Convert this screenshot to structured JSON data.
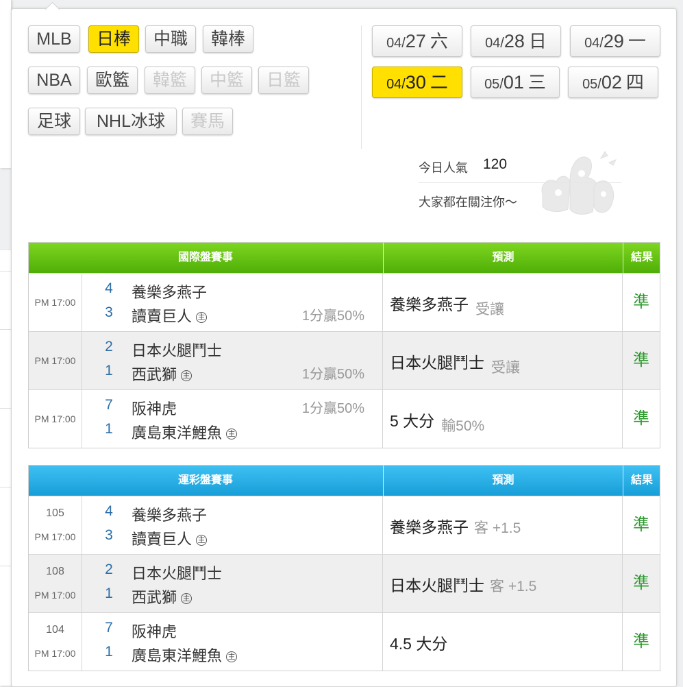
{
  "sports": [
    {
      "label": "MLB",
      "state": "normal"
    },
    {
      "label": "日棒",
      "state": "active"
    },
    {
      "label": "中職",
      "state": "normal"
    },
    {
      "label": "韓棒",
      "state": "normal"
    },
    {
      "label": "NBA",
      "state": "normal"
    },
    {
      "label": "歐籃",
      "state": "normal"
    },
    {
      "label": "韓籃",
      "state": "disabled"
    },
    {
      "label": "中籃",
      "state": "disabled"
    },
    {
      "label": "日籃",
      "state": "disabled"
    },
    {
      "label": "足球",
      "state": "normal"
    },
    {
      "label": "NHL冰球",
      "state": "normal"
    },
    {
      "label": "賽馬",
      "state": "disabled"
    }
  ],
  "dates": [
    {
      "month": "04/",
      "day": "27",
      "weekday": "六",
      "active": false
    },
    {
      "month": "04/",
      "day": "28",
      "weekday": "日",
      "active": false
    },
    {
      "month": "04/",
      "day": "29",
      "weekday": "一",
      "active": false
    },
    {
      "month": "04/",
      "day": "30",
      "weekday": "二",
      "active": true
    },
    {
      "month": "05/",
      "day": "01",
      "weekday": "三",
      "active": false
    },
    {
      "month": "05/",
      "day": "02",
      "weekday": "四",
      "active": false
    }
  ],
  "popularity": {
    "label": "今日人氣",
    "count": "120",
    "message": "大家都在關注你～"
  },
  "colors": {
    "active_yellow": "#ffe000",
    "green_header": "#5cb80e",
    "blue_header": "#1fa8e0",
    "score_blue": "#2b6ea8",
    "result_green": "#2f9a2f"
  },
  "international": {
    "header": {
      "match": "國際盤賽事",
      "prediction": "預測",
      "result": "結果"
    },
    "rows": [
      {
        "time": "PM 17:00",
        "away_score": "4",
        "away": "養樂多燕子",
        "home_score": "3",
        "home": "讀賣巨人",
        "home_mark": "主",
        "odds": "1分贏50%",
        "odds_line": 2,
        "pred": "養樂多燕子",
        "pred_note": "受讓",
        "result": "準"
      },
      {
        "time": "PM 17:00",
        "away_score": "2",
        "away": "日本火腿鬥士",
        "home_score": "1",
        "home": "西武獅",
        "home_mark": "主",
        "odds": "1分贏50%",
        "odds_line": 2,
        "pred": "日本火腿鬥士",
        "pred_note": "受讓",
        "result": "準"
      },
      {
        "time": "PM 17:00",
        "away_score": "7",
        "away": "阪神虎",
        "home_score": "1",
        "home": "廣島東洋鯉魚",
        "home_mark": "主",
        "odds": "1分贏50%",
        "odds_line": 1,
        "pred": "5 大分",
        "pred_note": "輸50%",
        "result": "準"
      }
    ]
  },
  "lottery": {
    "header": {
      "match": "運彩盤賽事",
      "prediction": "預測",
      "result": "結果"
    },
    "rows": [
      {
        "num": "105",
        "time": "PM 17:00",
        "away_score": "4",
        "away": "養樂多燕子",
        "home_score": "3",
        "home": "讀賣巨人",
        "home_mark": "主",
        "pred": "養樂多燕子",
        "pred_note": "客 +1.5",
        "result": "準"
      },
      {
        "num": "108",
        "time": "PM 17:00",
        "away_score": "2",
        "away": "日本火腿鬥士",
        "home_score": "1",
        "home": "西武獅",
        "home_mark": "主",
        "pred": "日本火腿鬥士",
        "pred_note": "客 +1.5",
        "result": "準"
      },
      {
        "num": "104",
        "time": "PM 17:00",
        "away_score": "7",
        "away": "阪神虎",
        "home_score": "1",
        "home": "廣島東洋鯉魚",
        "home_mark": "主",
        "pred": "4.5 大分",
        "pred_note": "",
        "result": "準"
      }
    ]
  }
}
